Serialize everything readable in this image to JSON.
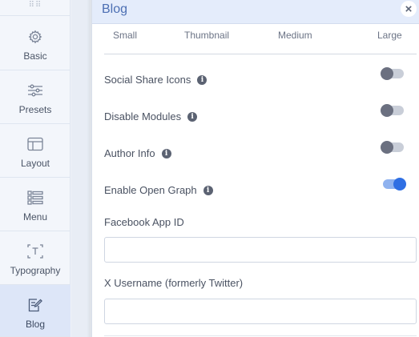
{
  "sidebar": {
    "items": [
      {
        "label": "Basic",
        "icon": "gear-icon"
      },
      {
        "label": "Presets",
        "icon": "sliders-icon"
      },
      {
        "label": "Layout",
        "icon": "layout-icon"
      },
      {
        "label": "Menu",
        "icon": "menu-list-icon"
      },
      {
        "label": "Typography",
        "icon": "typography-icon"
      },
      {
        "label": "Blog",
        "icon": "blog-edit-icon",
        "active": true
      }
    ]
  },
  "panel": {
    "title": "Blog",
    "close_label": "×",
    "image_sizes": [
      "Small",
      "Thumbnail",
      "Medium",
      "Large"
    ],
    "settings": [
      {
        "label": "Social Share Icons",
        "enabled": false
      },
      {
        "label": "Disable Modules",
        "enabled": false
      },
      {
        "label": "Author Info",
        "enabled": false
      },
      {
        "label": "Enable Open Graph",
        "enabled": true
      }
    ],
    "fields": [
      {
        "label": "Facebook App ID",
        "value": "",
        "placeholder": ""
      },
      {
        "label": "X Username (formerly Twitter)",
        "value": "",
        "placeholder": ""
      }
    ]
  },
  "colors": {
    "accent": "#2f6fe3",
    "title": "#4c6fb3",
    "header_bg": "#e4ecfb"
  }
}
